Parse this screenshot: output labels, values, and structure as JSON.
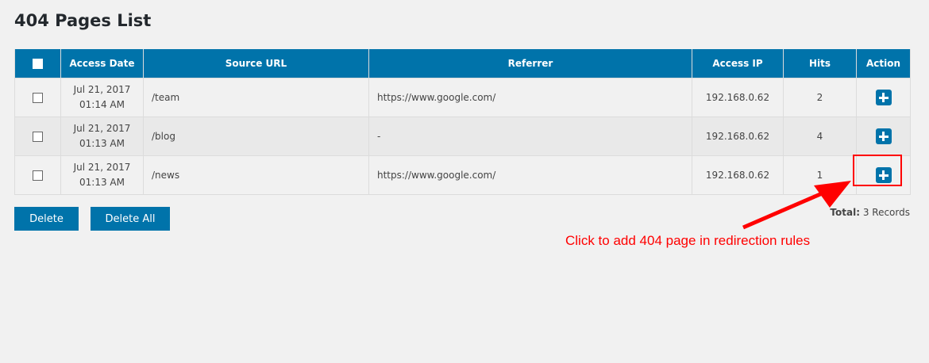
{
  "page_title": "404 Pages List",
  "columns": [
    "Access Date",
    "Source URL",
    "Referrer",
    "Access IP",
    "Hits",
    "Action"
  ],
  "rows": [
    {
      "date": "Jul 21, 2017",
      "time": "01:14 AM",
      "source": "/team",
      "referrer": "https://www.google.com/",
      "ip": "192.168.0.62",
      "hits": "2"
    },
    {
      "date": "Jul 21, 2017",
      "time": "01:13 AM",
      "source": "/blog",
      "referrer": "-",
      "ip": "192.168.0.62",
      "hits": "4"
    },
    {
      "date": "Jul 21, 2017",
      "time": "01:13 AM",
      "source": "/news",
      "referrer": "https://www.google.com/",
      "ip": "192.168.0.62",
      "hits": "1"
    }
  ],
  "buttons": {
    "delete": "Delete",
    "delete_all": "Delete All"
  },
  "total": {
    "label": "Total:",
    "value": "3 Records"
  },
  "annotation": "Click to add 404 page in redirection rules",
  "colors": {
    "accent": "#0073aa",
    "annotation": "#ff0000"
  }
}
